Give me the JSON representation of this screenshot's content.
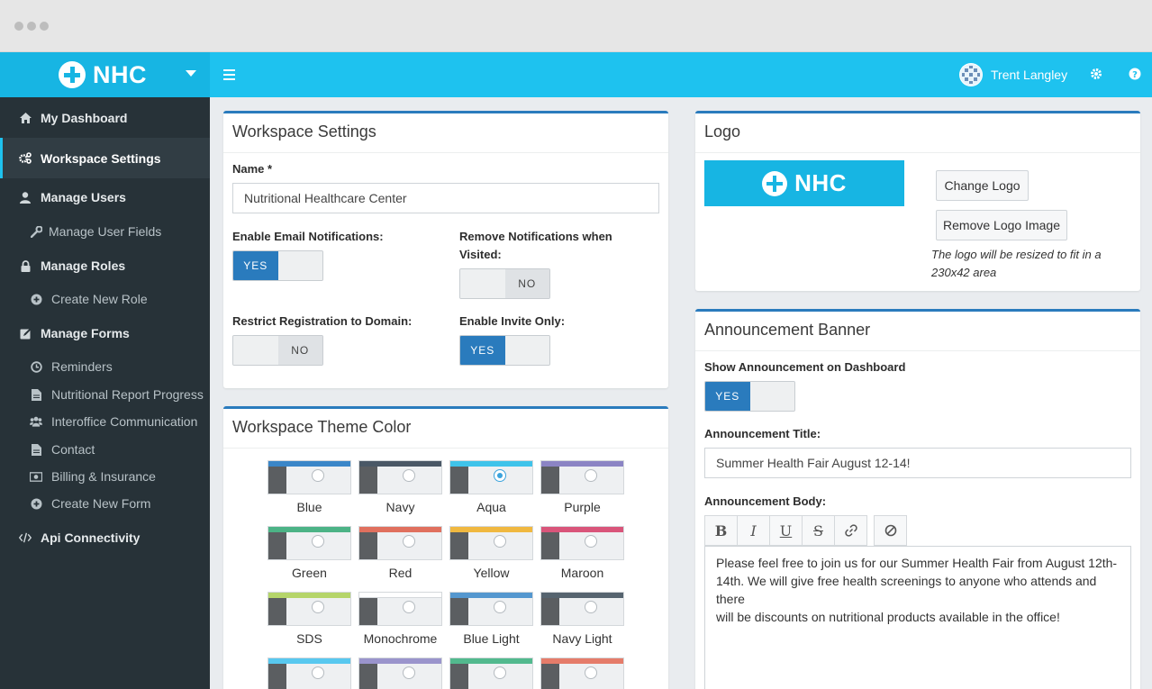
{
  "brand": {
    "name": "NHC"
  },
  "topbar": {
    "user_name": "Trent Langley",
    "icons": [
      "menu-icon",
      "gear-icon",
      "help-icon"
    ]
  },
  "sidebar": {
    "items": [
      {
        "label": "My Dashboard",
        "icon": "home-icon",
        "level": "main"
      },
      {
        "label": "Workspace Settings",
        "icon": "cogs-icon",
        "level": "main",
        "active": true
      },
      {
        "label": "Manage Users",
        "icon": "user-icon",
        "level": "main"
      },
      {
        "label": "Manage User Fields",
        "icon": "wrench-icon",
        "level": "sub"
      },
      {
        "label": "Manage Roles",
        "icon": "lock-icon",
        "level": "main"
      },
      {
        "label": "Create New Role",
        "icon": "plus-circle-icon",
        "level": "sub"
      },
      {
        "label": "Manage Forms",
        "icon": "edit-icon",
        "level": "main"
      },
      {
        "label": "Reminders",
        "icon": "clock-icon",
        "level": "sub"
      },
      {
        "label": "Nutritional Report Progress",
        "icon": "file-icon",
        "level": "sub"
      },
      {
        "label": "Interoffice Communication",
        "icon": "users-icon",
        "level": "sub"
      },
      {
        "label": "Contact",
        "icon": "file-icon",
        "level": "sub"
      },
      {
        "label": "Billing & Insurance",
        "icon": "money-icon",
        "level": "sub"
      },
      {
        "label": "Create New Form",
        "icon": "plus-circle-icon",
        "level": "sub"
      },
      {
        "label": "Api Connectivity",
        "icon": "code-icon",
        "level": "main"
      }
    ]
  },
  "workspace_settings": {
    "title": "Workspace Settings",
    "name_label": "Name *",
    "name_value": "Nutritional Healthcare Center",
    "email_notifications": {
      "label": "Enable Email Notifications:",
      "value": "YES"
    },
    "remove_notifications": {
      "label_line1": "Remove Notifications when",
      "label_line2": "Visited:",
      "value": "NO"
    },
    "restrict_registration": {
      "label": "Restrict Registration to Domain:",
      "value": "NO"
    },
    "invite_only": {
      "label": "Enable Invite Only:",
      "value": "YES"
    }
  },
  "theme": {
    "title": "Workspace Theme Color",
    "selected": "Aqua",
    "swatches": [
      {
        "name": "Blue",
        "color": "#3a86c8"
      },
      {
        "name": "Navy",
        "color": "#4a5866"
      },
      {
        "name": "Aqua",
        "color": "#3fc3ea"
      },
      {
        "name": "Purple",
        "color": "#8b84c4"
      },
      {
        "name": "Green",
        "color": "#4cb386"
      },
      {
        "name": "Red",
        "color": "#e0705e"
      },
      {
        "name": "Yellow",
        "color": "#f0b840"
      },
      {
        "name": "Maroon",
        "color": "#d9557a"
      },
      {
        "name": "SDS",
        "color": "#b5d56a"
      },
      {
        "name": "Monochrome",
        "color": "#ffffff"
      },
      {
        "name": "Blue Light",
        "color": "#5497cf"
      },
      {
        "name": "Navy Light",
        "color": "#56646f"
      },
      {
        "name": "",
        "color": "#58c8ef"
      },
      {
        "name": "",
        "color": "#9a94cc"
      },
      {
        "name": "",
        "color": "#52b98e"
      },
      {
        "name": "",
        "color": "#e57c6a"
      }
    ]
  },
  "logo": {
    "title": "Logo",
    "change_label": "Change Logo",
    "remove_label": "Remove Logo Image",
    "helper_line1": "The logo will be resized to fit in a",
    "helper_line2": "230x42 area"
  },
  "announcement": {
    "title": "Announcement Banner",
    "show_label": "Show Announcement on Dashboard",
    "show_value": "YES",
    "title_label": "Announcement Title:",
    "title_value": "Summer Health Fair August 12-14!",
    "body_label": "Announcement Body:",
    "toolbar": [
      "B",
      "I",
      "U",
      "S",
      "link",
      "clear"
    ],
    "body_line1": "Please feel free to join us for our Summer Health Fair from August 12th-",
    "body_line2": "14th. We will give free health screenings to anyone who attends and there",
    "body_line3": "will be discounts on nutritional products available in the office!"
  },
  "colors": {
    "accent": "#1ec2ef",
    "primary": "#2a7bbd",
    "sidebar_bg": "#273238"
  }
}
